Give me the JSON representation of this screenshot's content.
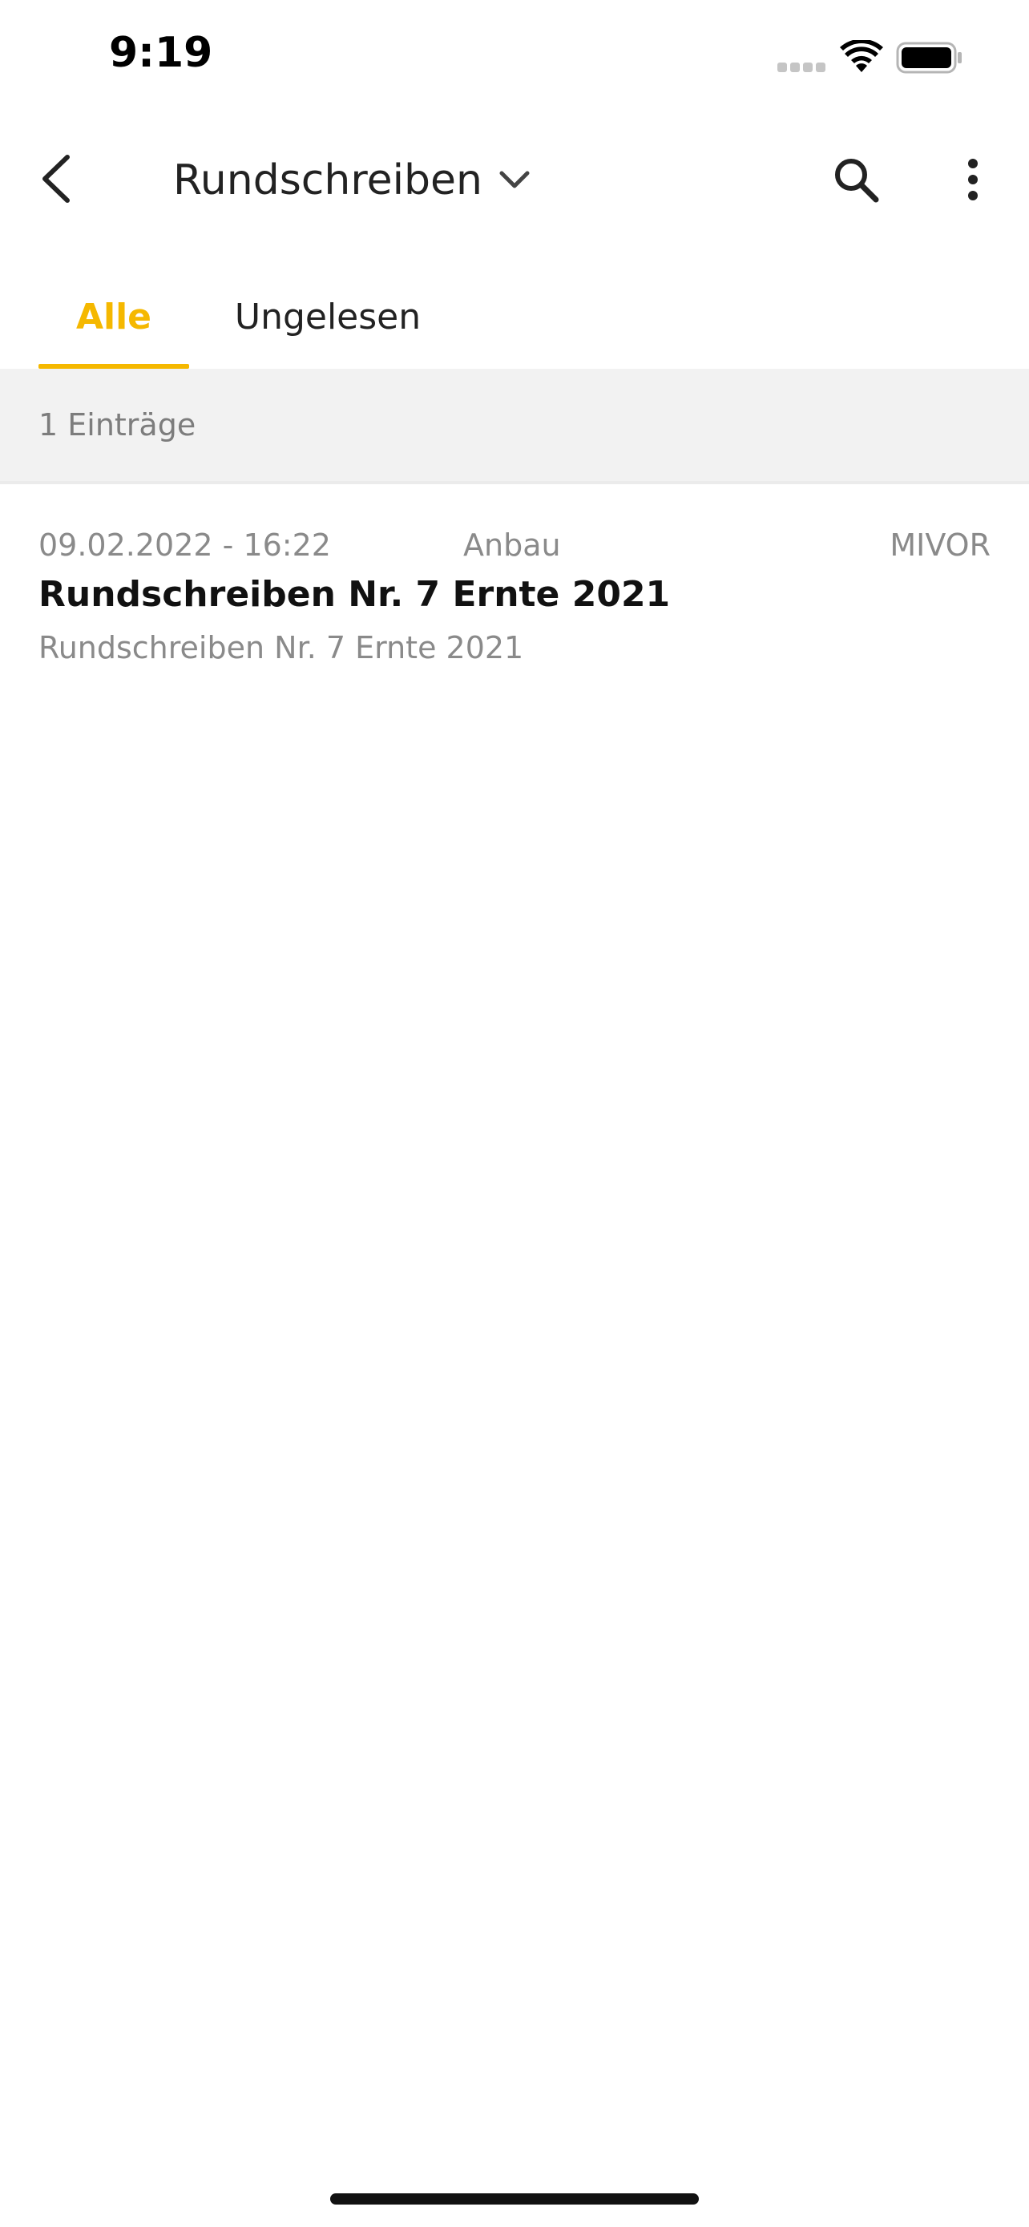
{
  "status_bar": {
    "time": "9:19",
    "signal_icon": "cellular-signal-icon",
    "wifi_icon": "wifi-icon",
    "battery_icon": "battery-icon"
  },
  "nav": {
    "back_icon": "chevron-left-icon",
    "title": "Rundschreiben",
    "title_dropdown_icon": "chevron-down-icon",
    "search_icon": "search-icon",
    "more_icon": "more-vertical-icon"
  },
  "tabs": [
    {
      "label": "Alle",
      "selected": true
    },
    {
      "label": "Ungelesen",
      "selected": false
    }
  ],
  "list": {
    "count_label": "1 Einträge",
    "items": [
      {
        "date": "09.02.2022 - 16:22",
        "category": "Anbau",
        "sender": "MIVOR",
        "title": "Rundschreiben Nr. 7 Ernte 2021",
        "preview": "Rundschreiben Nr. 7 Ernte 2021"
      }
    ]
  },
  "colors": {
    "accent": "#f5b800",
    "text_primary": "#222222",
    "text_secondary": "#8a8a8a",
    "strip_background": "#f2f2f2"
  }
}
